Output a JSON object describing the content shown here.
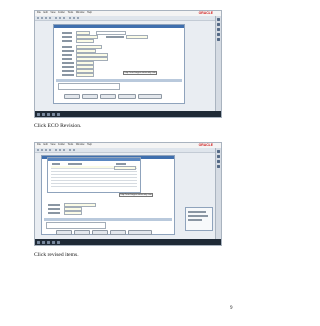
{
  "screenshot1": {
    "brand": "ORACLE",
    "url_tooltip": "http://oracleappscommunity.com",
    "menu": [
      "File",
      "Edit",
      "View",
      "Folder",
      "Tools",
      "Window",
      "Help"
    ]
  },
  "screenshot2": {
    "brand": "ORACLE",
    "url_tooltip": "http://oracleappscommunity.com",
    "menu": [
      "File",
      "Edit",
      "View",
      "Folder",
      "Tools",
      "Window",
      "Help"
    ]
  },
  "captions": {
    "first": "Click ECO Revision.",
    "second": "Click revised items."
  },
  "page_number": "9"
}
